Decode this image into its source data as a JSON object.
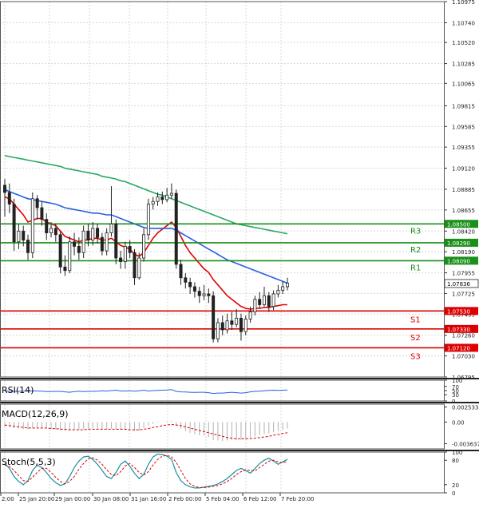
{
  "chart_data": {
    "type": "candlestick",
    "price_axis": {
      "ticks": [
        "1.10975",
        "1.10740",
        "1.10520",
        "1.10285",
        "1.10065",
        "1.09815",
        "1.09585",
        "1.09355",
        "1.09120",
        "1.08885",
        "1.08655",
        "1.08420",
        "1.08190",
        "1.07955",
        "1.07725",
        "1.07495",
        "1.07260",
        "1.07030",
        "1.06795"
      ],
      "min": 1.06795,
      "max": 1.10975,
      "current_price": "1.07836"
    },
    "time_axis": {
      "labels": [
        "2:00",
        "25 Jan 20:00",
        "29 Jan 00:00",
        "30 Jan 08:00",
        "31 Jan 16:00",
        "2 Feb 00:00",
        "5 Feb 04:00",
        "6 Feb 12:00",
        "7 Feb 20:00"
      ]
    },
    "levels": [
      {
        "name": "R3",
        "value": 1.085,
        "label": "1.08500",
        "color": "#1a8f1a"
      },
      {
        "name": "R2",
        "value": 1.0829,
        "label": "1.08290",
        "color": "#1a8f1a"
      },
      {
        "name": "R1",
        "value": 1.0809,
        "label": "1.08090",
        "color": "#1a8f1a"
      },
      {
        "name": "S1",
        "value": 1.0753,
        "label": "1.07530",
        "color": "#dd0000"
      },
      {
        "name": "S2",
        "value": 1.0733,
        "label": "1.07330",
        "color": "#dd0000"
      },
      {
        "name": "S3",
        "value": 1.0712,
        "label": "1.07120",
        "color": "#dd0000"
      }
    ],
    "candles": [
      [
        1.0893,
        1.0885,
        1.09,
        1.0858
      ],
      [
        1.0885,
        1.0872,
        1.0895,
        1.0862
      ],
      [
        1.0872,
        1.083,
        1.0878,
        1.082
      ],
      [
        1.083,
        1.0842,
        1.085,
        1.0822
      ],
      [
        1.0842,
        1.0832,
        1.0848,
        1.0825
      ],
      [
        1.0832,
        1.0818,
        1.0838,
        1.081
      ],
      [
        1.0818,
        1.0878,
        1.0885,
        1.0812
      ],
      [
        1.0878,
        1.0868,
        1.0882,
        1.0855
      ],
      [
        1.0868,
        1.0855,
        1.0875,
        1.0848
      ],
      [
        1.0855,
        1.084,
        1.0862,
        1.0832
      ],
      [
        1.084,
        1.0845,
        1.0852,
        1.0835
      ],
      [
        1.0845,
        1.0838,
        1.085,
        1.083
      ],
      [
        1.0838,
        1.0802,
        1.0842,
        1.0795
      ],
      [
        1.0802,
        1.0798,
        1.0815,
        1.0792
      ],
      [
        1.0798,
        1.083,
        1.0836,
        1.0795
      ],
      [
        1.083,
        1.0825,
        1.084,
        1.0815
      ],
      [
        1.0825,
        1.0818,
        1.0835,
        1.081
      ],
      [
        1.0818,
        1.0842,
        1.0848,
        1.0812
      ],
      [
        1.0842,
        1.0832,
        1.085,
        1.0825
      ],
      [
        1.0832,
        1.0845,
        1.0852,
        1.0826
      ],
      [
        1.0845,
        1.0835,
        1.085,
        1.0828
      ],
      [
        1.0835,
        1.082,
        1.084,
        1.0815
      ],
      [
        1.082,
        1.084,
        1.0845,
        1.0815
      ],
      [
        1.084,
        1.085,
        1.0892,
        1.0836
      ],
      [
        1.085,
        1.0812,
        1.0855,
        1.0805
      ],
      [
        1.0812,
        1.0808,
        1.082,
        1.08
      ],
      [
        1.0808,
        1.0825,
        1.083,
        1.08
      ],
      [
        1.0825,
        1.0818,
        1.0832,
        1.0812
      ],
      [
        1.0818,
        1.079,
        1.0822,
        1.0782
      ],
      [
        1.079,
        1.0812,
        1.0818,
        1.0788
      ],
      [
        1.0812,
        1.0838,
        1.0845,
        1.0808
      ],
      [
        1.0838,
        1.0872,
        1.0878,
        1.0832
      ],
      [
        1.0872,
        1.0875,
        1.088,
        1.0866
      ],
      [
        1.0875,
        1.088,
        1.0885,
        1.087
      ],
      [
        1.088,
        1.0877,
        1.0886,
        1.0872
      ],
      [
        1.0877,
        1.0882,
        1.089,
        1.0874
      ],
      [
        1.0882,
        1.0884,
        1.0895,
        1.0878
      ],
      [
        1.0884,
        1.0805,
        1.0888,
        1.08
      ],
      [
        1.0805,
        1.079,
        1.081,
        1.0782
      ],
      [
        1.079,
        1.0785,
        1.0795,
        1.0778
      ],
      [
        1.0785,
        1.078,
        1.079,
        1.0772
      ],
      [
        1.078,
        1.0775,
        1.0785,
        1.0768
      ],
      [
        1.0775,
        1.077,
        1.078,
        1.0762
      ],
      [
        1.077,
        1.0772,
        1.0782,
        1.0765
      ],
      [
        1.0772,
        1.077,
        1.0778,
        1.0762
      ],
      [
        1.077,
        1.0722,
        1.0775,
        1.0718
      ],
      [
        1.0722,
        1.074,
        1.0745,
        1.0718
      ],
      [
        1.074,
        1.0732,
        1.0748,
        1.0726
      ],
      [
        1.0732,
        1.0742,
        1.075,
        1.0728
      ],
      [
        1.0742,
        1.0738,
        1.0752,
        1.0732
      ],
      [
        1.0738,
        1.0745,
        1.0755,
        1.0735
      ],
      [
        1.0745,
        1.073,
        1.075,
        1.072
      ],
      [
        1.073,
        1.0744,
        1.0748,
        1.0726
      ],
      [
        1.0744,
        1.0752,
        1.0758,
        1.074
      ],
      [
        1.0752,
        1.0766,
        1.077,
        1.0748
      ],
      [
        1.0766,
        1.076,
        1.0774,
        1.0756
      ],
      [
        1.076,
        1.077,
        1.078,
        1.0758
      ],
      [
        1.077,
        1.0758,
        1.0774,
        1.0752
      ],
      [
        1.0758,
        1.0772,
        1.0776,
        1.0754
      ],
      [
        1.0772,
        1.0776,
        1.0782,
        1.0768
      ],
      [
        1.0776,
        1.078,
        1.0786,
        1.0772
      ],
      [
        1.078,
        1.0784,
        1.079,
        1.0776
      ]
    ],
    "moving_averages": [
      {
        "color": "#e00000",
        "values": [
          1.088,
          1.0878,
          1.0872,
          1.0866,
          1.086,
          1.0852,
          1.0854,
          1.0856,
          1.0856,
          1.0852,
          1.085,
          1.0848,
          1.0842,
          1.0836,
          1.0834,
          1.0832,
          1.083,
          1.0832,
          1.0832,
          1.0834,
          1.0834,
          1.0832,
          1.0832,
          1.0834,
          1.083,
          1.0826,
          1.0824,
          1.0822,
          1.0816,
          1.0814,
          1.0818,
          1.0826,
          1.0834,
          1.084,
          1.0844,
          1.0848,
          1.0852,
          1.0846,
          1.0836,
          1.0826,
          1.0818,
          1.0812,
          1.0806,
          1.08,
          1.0796,
          1.0788,
          1.0782,
          1.0776,
          1.077,
          1.0766,
          1.0762,
          1.0758,
          1.0756,
          1.0755,
          1.0756,
          1.0756,
          1.0757,
          1.0757,
          1.0758,
          1.0759,
          1.076,
          1.076
        ]
      },
      {
        "color": "#2860e0",
        "values": [
          1.0888,
          1.0886,
          1.0884,
          1.0882,
          1.088,
          1.0878,
          1.0877,
          1.0876,
          1.0875,
          1.0874,
          1.0873,
          1.0872,
          1.087,
          1.0868,
          1.0867,
          1.0866,
          1.0865,
          1.0864,
          1.0863,
          1.0862,
          1.0862,
          1.0861,
          1.086,
          1.086,
          1.0858,
          1.0856,
          1.0854,
          1.0852,
          1.085,
          1.0848,
          1.0846,
          1.0845,
          1.0845,
          1.0845,
          1.0845,
          1.0845,
          1.0845,
          1.0843,
          1.084,
          1.0837,
          1.0834,
          1.0831,
          1.0828,
          1.0825,
          1.0822,
          1.0819,
          1.0816,
          1.0813,
          1.081,
          1.0808,
          1.0806,
          1.0804,
          1.0802,
          1.08,
          1.0798,
          1.0796,
          1.0794,
          1.0792,
          1.079,
          1.0788,
          1.0786,
          1.0784
        ]
      },
      {
        "color": "#2aa860",
        "values": [
          1.0926,
          1.0925,
          1.0924,
          1.0923,
          1.0922,
          1.0921,
          1.092,
          1.0919,
          1.0918,
          1.0917,
          1.0916,
          1.0915,
          1.0914,
          1.0912,
          1.0911,
          1.091,
          1.0909,
          1.0908,
          1.0907,
          1.0906,
          1.0905,
          1.0903,
          1.0902,
          1.0901,
          1.09,
          1.0898,
          1.0897,
          1.0895,
          1.0893,
          1.0891,
          1.0889,
          1.0887,
          1.0885,
          1.0883,
          1.0882,
          1.088,
          1.0878,
          1.0876,
          1.0874,
          1.0872,
          1.087,
          1.0868,
          1.0866,
          1.0864,
          1.0862,
          1.086,
          1.0858,
          1.0856,
          1.0854,
          1.0852,
          1.085,
          1.0849,
          1.0848,
          1.0847,
          1.0846,
          1.0845,
          1.0844,
          1.0843,
          1.0842,
          1.0841,
          1.084,
          1.0839
        ]
      }
    ],
    "indicators": [
      {
        "name": "RSI(14)",
        "color": "#2860e0",
        "ticks": [
          "100",
          "70",
          "50",
          "30",
          "0"
        ],
        "min": 0,
        "max": 100,
        "values": [
          48,
          47,
          46,
          46,
          47,
          50,
          48,
          48,
          47,
          45,
          45,
          46,
          46,
          44,
          42,
          45,
          47,
          45,
          46,
          46,
          47,
          49,
          48,
          50,
          52,
          48,
          48,
          49,
          47,
          49,
          52,
          48,
          50,
          51,
          52,
          53,
          55,
          46,
          44,
          43,
          42,
          41,
          42,
          42,
          40,
          36,
          38,
          38,
          40,
          42,
          40,
          38,
          40,
          44,
          46,
          47,
          49,
          51,
          52,
          51,
          52,
          53
        ]
      },
      {
        "name": "MACD(12,26,9)",
        "color": "#dd0000",
        "ticks": [
          "0.002533",
          "0.00",
          "-0.003637"
        ],
        "min": -0.0045,
        "max": 0.003,
        "histogram": [
          -0.0008,
          -0.0009,
          -0.001,
          -0.0011,
          -0.0012,
          -0.0012,
          -0.001,
          -0.0009,
          -0.001,
          -0.0011,
          -0.0012,
          -0.0013,
          -0.0014,
          -0.0015,
          -0.0014,
          -0.0013,
          -0.0013,
          -0.0012,
          -0.0011,
          -0.001,
          -0.0011,
          -0.0012,
          -0.0012,
          -0.0011,
          -0.0012,
          -0.0013,
          -0.0013,
          -0.0013,
          -0.0015,
          -0.0014,
          -0.001,
          -0.0006,
          -0.0003,
          -0.0001,
          0.0,
          0.0001,
          0.0002,
          -0.0006,
          -0.0011,
          -0.0015,
          -0.0018,
          -0.002,
          -0.0022,
          -0.0023,
          -0.0025,
          -0.003,
          -0.0031,
          -0.0032,
          -0.0031,
          -0.003,
          -0.003,
          -0.003,
          -0.0029,
          -0.0026,
          -0.0024,
          -0.0022,
          -0.002,
          -0.0019,
          -0.0017,
          -0.0015,
          -0.0013,
          -0.0011
        ],
        "signal": [
          -0.0005,
          -0.0006,
          -0.0007,
          -0.0008,
          -0.0009,
          -0.001,
          -0.001,
          -0.001,
          -0.001,
          -0.001,
          -0.0011,
          -0.0011,
          -0.0012,
          -0.0012,
          -0.0013,
          -0.0013,
          -0.0013,
          -0.0013,
          -0.0012,
          -0.0012,
          -0.0012,
          -0.0012,
          -0.0012,
          -0.0012,
          -0.0012,
          -0.0012,
          -0.0012,
          -0.0013,
          -0.0013,
          -0.0013,
          -0.0012,
          -0.0011,
          -0.0009,
          -0.0008,
          -0.0006,
          -0.0005,
          -0.0004,
          -0.0005,
          -0.0006,
          -0.0008,
          -0.001,
          -0.0012,
          -0.0014,
          -0.0016,
          -0.0018,
          -0.002,
          -0.0022,
          -0.0024,
          -0.0026,
          -0.0027,
          -0.0028,
          -0.0028,
          -0.0028,
          -0.0028,
          -0.0027,
          -0.0026,
          -0.0025,
          -0.0024,
          -0.0022,
          -0.0021,
          -0.0019,
          -0.0018
        ]
      },
      {
        "name": "Stoch(5,5,3)",
        "color": "#1a8fa0",
        "ticks": [
          "100",
          "80",
          "20",
          "0"
        ],
        "min": 0,
        "max": 100,
        "k": [
          72,
          60,
          40,
          28,
          20,
          30,
          55,
          68,
          62,
          50,
          35,
          25,
          18,
          22,
          40,
          62,
          78,
          88,
          90,
          82,
          70,
          55,
          40,
          35,
          50,
          70,
          78,
          65,
          48,
          35,
          45,
          70,
          88,
          95,
          94,
          90,
          82,
          50,
          30,
          20,
          15,
          12,
          12,
          14,
          16,
          18,
          22,
          28,
          35,
          45,
          55,
          60,
          55,
          48,
          60,
          72,
          80,
          85,
          78,
          70,
          76,
          82
        ],
        "d": [
          68,
          65,
          55,
          42,
          30,
          28,
          38,
          50,
          60,
          60,
          50,
          38,
          28,
          22,
          28,
          40,
          58,
          72,
          84,
          86,
          80,
          70,
          56,
          45,
          42,
          52,
          66,
          72,
          62,
          50,
          44,
          52,
          68,
          82,
          90,
          92,
          88,
          75,
          55,
          35,
          22,
          16,
          13,
          13,
          14,
          16,
          18,
          22,
          28,
          35,
          45,
          52,
          56,
          55,
          54,
          62,
          70,
          78,
          80,
          76,
          74,
          77
        ]
      }
    ]
  }
}
